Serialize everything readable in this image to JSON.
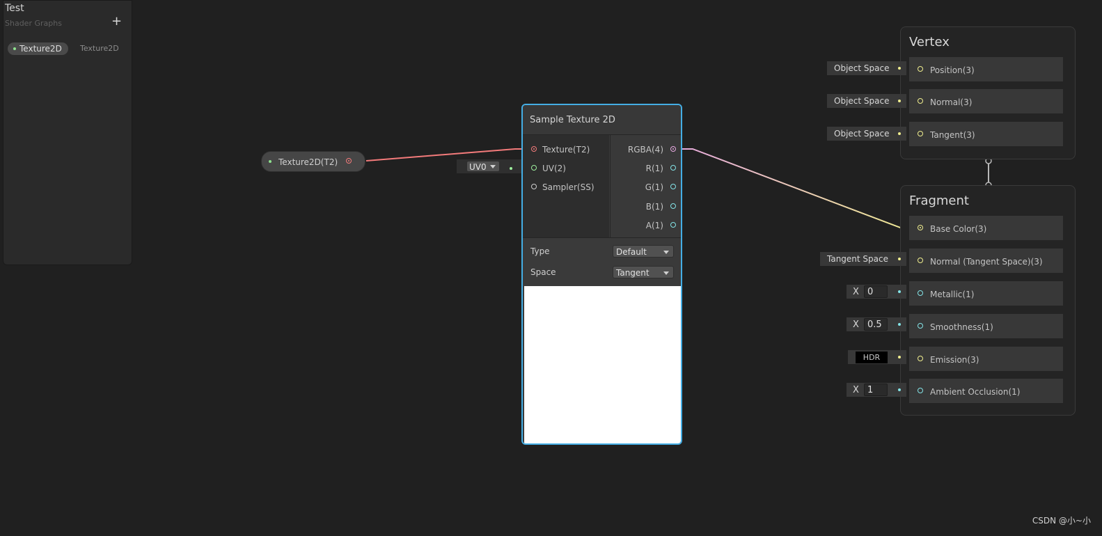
{
  "blackboard": {
    "title": "Test",
    "subtitle": "Shader Graphs",
    "add_symbol": "+",
    "property_name": "Texture2D",
    "property_type": "Texture2D"
  },
  "property_node": {
    "label": "Texture2D(T2)"
  },
  "uv_input": {
    "value": "UV0"
  },
  "sample_node": {
    "title": "Sample Texture 2D",
    "inputs": [
      "Texture(T2)",
      "UV(2)",
      "Sampler(SS)"
    ],
    "outputs": [
      "RGBA(4)",
      "R(1)",
      "G(1)",
      "B(1)",
      "A(1)"
    ],
    "type_label": "Type",
    "type_value": "Default",
    "space_label": "Space",
    "space_value": "Tangent"
  },
  "vertex": {
    "title": "Vertex",
    "blocks": [
      {
        "label": "Position(3)",
        "input": "Object Space"
      },
      {
        "label": "Normal(3)",
        "input": "Object Space"
      },
      {
        "label": "Tangent(3)",
        "input": "Object Space"
      }
    ]
  },
  "fragment": {
    "title": "Fragment",
    "blocks": [
      {
        "label": "Base Color(3)"
      },
      {
        "label": "Normal (Tangent Space)(3)",
        "input": "Tangent Space"
      },
      {
        "label": "Metallic(1)",
        "x_label": "X",
        "value": "0"
      },
      {
        "label": "Smoothness(1)",
        "x_label": "X",
        "value": "0.5"
      },
      {
        "label": "Emission(3)",
        "hdr": "HDR"
      },
      {
        "label": "Ambient Occlusion(1)",
        "x_label": "X",
        "value": "1"
      }
    ]
  },
  "colors": {
    "selection": "#44aee5",
    "texture_wire": "#f47b7b",
    "vector3": "#f0ee8f",
    "vector1": "#84e4e7",
    "vector4": "#e7a8e0",
    "vector2": "#9ef09e"
  },
  "watermark": "CSDN @小~小"
}
